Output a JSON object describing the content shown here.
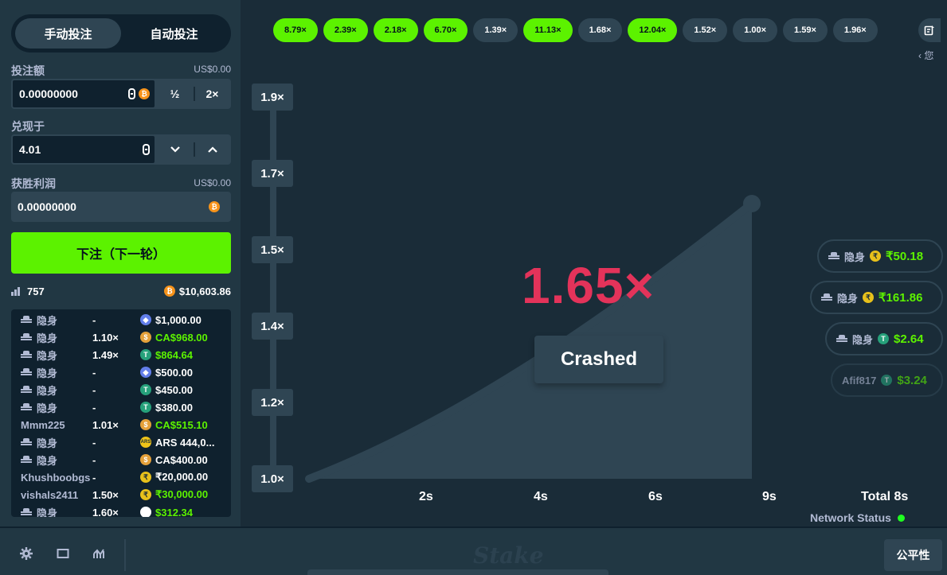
{
  "mode_tabs": {
    "manual": "手动投注",
    "auto": "自动投注"
  },
  "bet_amount": {
    "label": "投注额",
    "usd": "US$0.00",
    "value": "0.00000000",
    "half": "½",
    "double": "2×"
  },
  "cashout": {
    "label": "兑现于",
    "value": "4.01"
  },
  "profit": {
    "label": "获胜利润",
    "usd": "US$0.00",
    "value": "0.00000000"
  },
  "bet_button": "下注（下一轮）",
  "stats": {
    "players": "757",
    "total": "$10,603.86"
  },
  "bets": [
    {
      "user": "隐身",
      "hidden": true,
      "mult": "-",
      "coin": "eth",
      "amount": "$1,000.00",
      "win": false
    },
    {
      "user": "隐身",
      "hidden": true,
      "mult": "1.10×",
      "coin": "cad",
      "amount": "CA$968.00",
      "win": true
    },
    {
      "user": "隐身",
      "hidden": true,
      "mult": "1.49×",
      "coin": "usdt",
      "amount": "$864.64",
      "win": true
    },
    {
      "user": "隐身",
      "hidden": true,
      "mult": "-",
      "coin": "eth",
      "amount": "$500.00",
      "win": false
    },
    {
      "user": "隐身",
      "hidden": true,
      "mult": "-",
      "coin": "usdt",
      "amount": "$450.00",
      "win": false
    },
    {
      "user": "隐身",
      "hidden": true,
      "mult": "-",
      "coin": "usdt",
      "amount": "$380.00",
      "win": false
    },
    {
      "user": "Mmm225",
      "hidden": false,
      "mult": "1.01×",
      "coin": "cad",
      "amount": "CA$515.10",
      "win": true
    },
    {
      "user": "隐身",
      "hidden": true,
      "mult": "-",
      "coin": "ars",
      "amount": "ARS 444,0...",
      "win": false
    },
    {
      "user": "隐身",
      "hidden": true,
      "mult": "-",
      "coin": "cad",
      "amount": "CA$400.00",
      "win": false
    },
    {
      "user": "Khushboobgs",
      "hidden": false,
      "mult": "-",
      "coin": "inr",
      "amount": "₹20,000.00",
      "win": false
    },
    {
      "user": "vishals2411",
      "hidden": false,
      "mult": "1.50×",
      "coin": "inr",
      "amount": "₹30,000.00",
      "win": true
    },
    {
      "user": "隐身",
      "hidden": true,
      "mult": "1.60×",
      "coin": "white",
      "amount": "$312.34",
      "win": true
    }
  ],
  "history": [
    {
      "value": "8.79×",
      "green": true
    },
    {
      "value": "2.39×",
      "green": true
    },
    {
      "value": "2.18×",
      "green": true
    },
    {
      "value": "6.70×",
      "green": true
    },
    {
      "value": "1.39×",
      "green": false
    },
    {
      "value": "11.13×",
      "green": true
    },
    {
      "value": "1.68×",
      "green": false
    },
    {
      "value": "12.04×",
      "green": true
    },
    {
      "value": "1.52×",
      "green": false
    },
    {
      "value": "1.00×",
      "green": false
    },
    {
      "value": "1.59×",
      "green": false
    },
    {
      "value": "1.96×",
      "green": false
    }
  ],
  "you_label": "‹ 您",
  "y_ticks": [
    "1.9×",
    "1.7×",
    "1.5×",
    "1.4×",
    "1.2×",
    "1.0×"
  ],
  "x_ticks": [
    "2s",
    "4s",
    "6s",
    "9s"
  ],
  "total_time": "Total 8s",
  "crash_multiplier": "1.65×",
  "crashed_label": "Crashed",
  "network_status": "Network Status",
  "win_pills": [
    {
      "user": "隐身",
      "coin": "inr",
      "amount": "₹50.18"
    },
    {
      "user": "隐身",
      "coin": "inr",
      "amount": "₹161.86"
    },
    {
      "user": "隐身",
      "coin": "usdt",
      "amount": "$2.64"
    },
    {
      "user": "Afif817",
      "coin": "usdt",
      "amount": "$3.24"
    }
  ],
  "logo_text": "Stake",
  "fairness_button": "公平性",
  "colors": {
    "accent_green": "#5cf200",
    "crash_red": "#e3335a",
    "panel": "#213743",
    "bg": "#1a2c38"
  }
}
